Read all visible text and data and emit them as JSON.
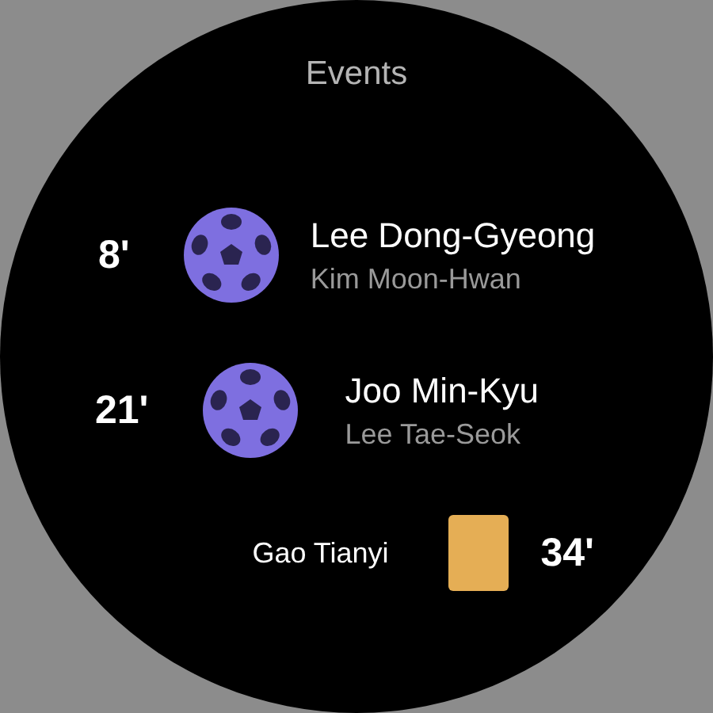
{
  "title": "Events",
  "events": [
    {
      "kind": "goal",
      "minute": "8'",
      "scorer": "Lee Dong-Gyeong",
      "assist": "Kim Moon-Hwan"
    },
    {
      "kind": "goal",
      "minute": "21'",
      "scorer": "Joo Min-Kyu",
      "assist": "Lee Tae-Seok"
    },
    {
      "kind": "card",
      "minute": "34'",
      "player": "Gao Tianyi",
      "color": "#e5ae55"
    }
  ]
}
